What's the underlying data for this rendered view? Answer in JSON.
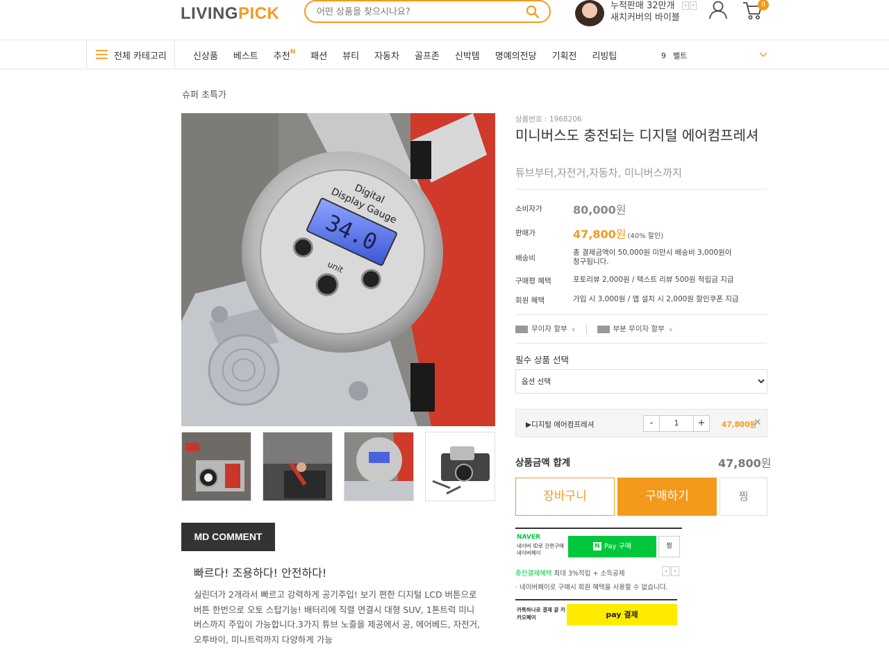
{
  "header": {
    "logo_part1": "LIVING",
    "logo_part2": "PICK",
    "search_placeholder": "어떤 상품을 찾으시나요?",
    "promo_line1": "누적판매 32만개",
    "promo_line2": "새치커버의 바이블",
    "cart_count": "0"
  },
  "nav": {
    "all_categories": "전체 카테고리",
    "items": [
      {
        "label": "신상품"
      },
      {
        "label": "베스트"
      },
      {
        "label": "추천",
        "badge": "N"
      },
      {
        "label": "패션"
      },
      {
        "label": "뷰티"
      },
      {
        "label": "자동차"
      },
      {
        "label": "골프존"
      },
      {
        "label": "신박템"
      },
      {
        "label": "명예의전당"
      },
      {
        "label": "기획전"
      },
      {
        "label": "리빙팁"
      }
    ],
    "rank_number": "9",
    "rank_keyword": "벨트"
  },
  "breadcrumb": "슈퍼 초특가",
  "product": {
    "id_label": "상품번호 : 1968206",
    "title": "미니버스도 충전되는 디지털 에어컴프레셔",
    "subtitle": "튜브부터,자전거,자동차, 미니버스까지",
    "gauge_reading": "34.0",
    "rows": {
      "consumer_price_label": "소비자가",
      "consumer_price": "80,000",
      "sale_price_label": "판매가",
      "sale_price": "47,800",
      "currency": "원",
      "discount": "(40% 할인)",
      "shipping_label": "배송비",
      "shipping_line1": "총 결제금액이 50,000원 미만시 배송비 3,000원이",
      "shipping_line2": "청구됩니다.",
      "buyer_benefit_label": "구매평 혜택",
      "buyer_benefit": "포토리뷰 2,000원 / 텍스트 리뷰 500원 적립금 지급",
      "member_benefit_label": "회원 혜택",
      "member_benefit": "가입 시 3,000원 / 앱 설치 시 2,000원 할인쿠폰 지급"
    },
    "installment_free": "무이자 할부",
    "installment_partial": "부분 무이자 할부",
    "required_label": "필수 상품 선택",
    "option_placeholder": "옵션 선택",
    "selected": {
      "name": "▶디지털 에어컴프레셔",
      "qty": "1",
      "price": "47,800원",
      "minus": "-",
      "plus": "+"
    },
    "total_label": "상품금액 합계",
    "total_value": "47,800",
    "cart_button": "장바구니",
    "buy_button": "구매하기",
    "wish_button": "찜"
  },
  "md": {
    "tab": "MD COMMENT",
    "title": "빠르다! 조용하다! 안전하다!",
    "text": "실린더가 2개라서 빠르고 강력하게 공기주입! 보기 편한 디지털 LCD 버튼으로 버튼 한번으로 오토 스탑기능! 배터리에 직렬 연결시 대형 SUV, 1톤트럭 미니버스까지 주입이 가능합니다.3가지 튜브 노즐을 제공에서 공, 에어베드, 자전거, 오투바이, 미니트럭까지 다양하게 가능"
  },
  "naverpay": {
    "brand": "NAVER",
    "desc": "네이버 ID로 간편구매 네이버페이",
    "button": "Pay 구매",
    "n_mark": "N",
    "wish": "찜",
    "benefit_highlight": "충전결제혜택",
    "benefit_rest": " 최대 3%적립 + 소득공제",
    "note": "· 네이버페이로 구매시 회원 혜택을 사용할 수 없습니다."
  },
  "kakaopay": {
    "desc": "카톡하나로 결제 끝 카카오페이",
    "button": "pay 결제"
  },
  "colors": {
    "accent": "#f39a1d",
    "naver_green": "#00c73c",
    "kakao_yellow": "#ffeb00"
  }
}
